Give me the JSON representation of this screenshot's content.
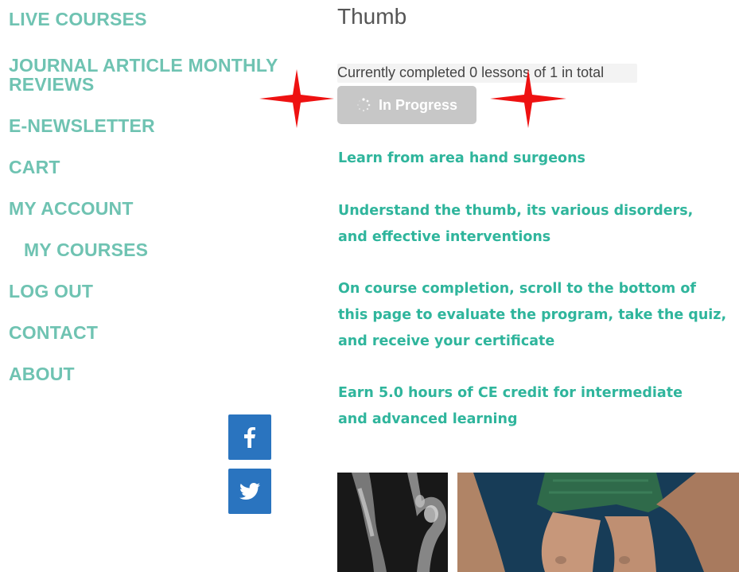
{
  "nav": {
    "items": [
      {
        "label": "LIVE COURSES"
      },
      {
        "label": "JOURNAL ARTICLE MONTHLY REVIEWS"
      },
      {
        "label": "E-NEWSLETTER"
      },
      {
        "label": "CART"
      },
      {
        "label": "MY ACCOUNT"
      },
      {
        "label": "MY COURSES"
      },
      {
        "label": "LOG OUT"
      },
      {
        "label": "CONTACT"
      },
      {
        "label": "ABOUT"
      }
    ]
  },
  "social": {
    "facebook_icon": "facebook-icon",
    "twitter_icon": "twitter-icon"
  },
  "course": {
    "title": "Thumb",
    "progress_text": "Currently completed 0 lessons of 1 in total",
    "status_label": "In Progress",
    "paragraphs": [
      "Learn from area hand surgeons",
      "Understand the thumb, its various disorders, and effective interventions",
      "On course completion, scroll to the bottom of this page to evaluate the program, take the quiz, and receive your certificate",
      "Earn 5.0 hours of CE credit for intermediate and advanced learning"
    ]
  },
  "colors": {
    "nav_text": "#6fc3b2",
    "body_text": "#2fb59c",
    "social_bg": "#2a74bf",
    "button_bg": "#c7c7c7",
    "star": "#ee1111"
  }
}
